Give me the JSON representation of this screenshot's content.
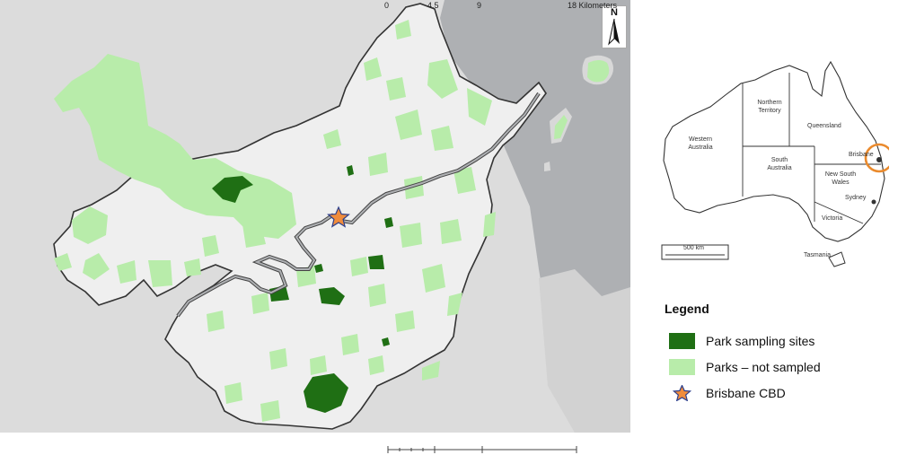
{
  "map": {
    "scale_labels": [
      "0",
      "4.5",
      "9",
      "18 Kilometers"
    ],
    "north_label": "N"
  },
  "inset": {
    "states": [
      "Western Australia",
      "Northern Territory",
      "South Australia",
      "Queensland",
      "New South Wales",
      "Victoria",
      "Tasmania"
    ],
    "cities": [
      "Brisbane",
      "Sydney"
    ],
    "scale_label": "500 km"
  },
  "legend": {
    "title": "Legend",
    "items": [
      {
        "label": "Park sampling sites",
        "color": "#1f6f14"
      },
      {
        "label": "Parks – not sampled",
        "color": "#b8ecaa"
      },
      {
        "label": "Brisbane CBD",
        "icon": "star-icon"
      }
    ]
  },
  "colors": {
    "water": "#aeb0b3",
    "land_outside": "#dcdcdc",
    "land_inside": "#efefef",
    "boundary": "#333333",
    "inset_highlight": "#ea8a2d",
    "star_fill": "#f08c3c",
    "star_stroke": "#2d3f8c"
  }
}
